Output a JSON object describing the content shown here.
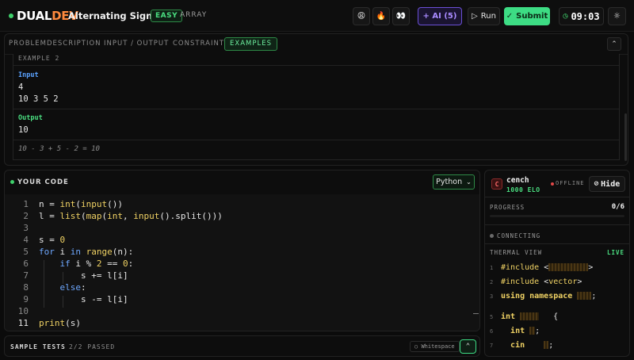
{
  "header": {
    "brand_part1": "DUAL",
    "brand_part2": "DEV",
    "problem_title": "Alternating Sign Sum",
    "difficulty": "EASY",
    "tag": "ARRAY",
    "emoji_buttons": [
      "😩",
      "🔥",
      "👀"
    ],
    "ai_label": "+ AI (5)",
    "run_label": "Run",
    "submit_label": "Submit",
    "timer": "09:03"
  },
  "problem_tabs": [
    "PROBLEM",
    "DESCRIPTION",
    "INPUT / OUTPUT",
    "CONSTRAINTS",
    "EXAMPLES"
  ],
  "active_tab": "EXAMPLES",
  "example": {
    "heading": "EXAMPLE 2",
    "input_label": "Input",
    "input_lines": [
      "4",
      "10 3 5 2"
    ],
    "output_label": "Output",
    "output_lines": [
      "10"
    ],
    "explanation": "10 - 3 + 5 - 2 = 10"
  },
  "editor": {
    "title": "YOUR CODE",
    "language": "Python",
    "line_numbers": [
      "1",
      "2",
      "3",
      "4",
      "5",
      "6",
      "7",
      "8",
      "9",
      "10",
      "11"
    ]
  },
  "tests": {
    "title": "SAMPLE TESTS",
    "passed": "2/2 PASSED",
    "whitespace_label": "Whitespace"
  },
  "opponent": {
    "avatar_letter": "C",
    "name": "cench",
    "elo": "1000 ELO",
    "status": "OFFLINE",
    "hide_label": "Hide",
    "progress_label": "PROGRESS",
    "progress_value": "0/6",
    "progress_fraction": 0,
    "connection": "CONNECTING",
    "thermal_label": "THERMAL VIEW",
    "live_label": "LIVE",
    "thermal_line_numbers": [
      "1",
      "2",
      "3",
      "5",
      "6",
      "7"
    ],
    "thermal_lines": [
      "#include",
      "#include",
      "using namespace",
      "int",
      "int",
      "cin"
    ]
  },
  "colors": {
    "accent_green": "#3ddc84",
    "brand_orange": "#ff8a3d",
    "ai_purple": "#a98bff",
    "input_blue": "#5aa2ff",
    "offline_red": "#e04848"
  }
}
